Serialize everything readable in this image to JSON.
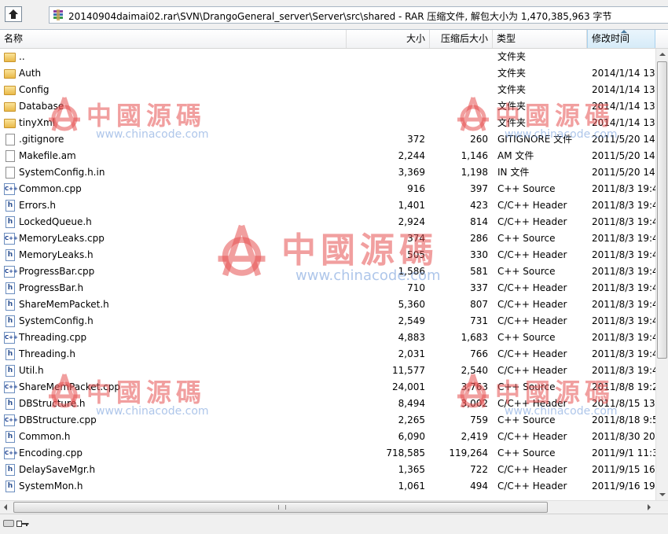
{
  "pathbar": {
    "path": "20140904daimai02.rar\\SVN\\DrangoGeneral_server\\Server\\src\\shared - RAR 压缩文件, 解包大小为 1,470,385,963 字节"
  },
  "columns": {
    "name": "名称",
    "size": "大小",
    "packed": "压缩后大小",
    "type": "类型",
    "modified": "修改时间"
  },
  "files": [
    {
      "icon": "folder-up-icon",
      "name": "..",
      "size": "",
      "packed": "",
      "type": "文件夹",
      "date": ""
    },
    {
      "icon": "folder-icon",
      "name": "Auth",
      "size": "",
      "packed": "",
      "type": "文件夹",
      "date": "2014/1/14 13"
    },
    {
      "icon": "folder-icon",
      "name": "Config",
      "size": "",
      "packed": "",
      "type": "文件夹",
      "date": "2014/1/14 13"
    },
    {
      "icon": "folder-icon",
      "name": "Database",
      "size": "",
      "packed": "",
      "type": "文件夹",
      "date": "2014/1/14 13"
    },
    {
      "icon": "folder-icon",
      "name": "tinyXml",
      "size": "",
      "packed": "",
      "type": "文件夹",
      "date": "2014/1/14 13"
    },
    {
      "icon": "file-icon",
      "name": ".gitignore",
      "size": "372",
      "packed": "260",
      "type": "GITIGNORE 文件",
      "date": "2011/5/20 14"
    },
    {
      "icon": "file-icon",
      "name": "Makefile.am",
      "size": "2,244",
      "packed": "1,146",
      "type": "AM 文件",
      "date": "2011/5/20 14"
    },
    {
      "icon": "file-icon",
      "name": "SystemConfig.h.in",
      "size": "3,369",
      "packed": "1,198",
      "type": "IN 文件",
      "date": "2011/5/20 14"
    },
    {
      "icon": "cpp-file-icon",
      "name": "Common.cpp",
      "size": "916",
      "packed": "397",
      "type": "C++ Source",
      "date": "2011/8/3 19:4"
    },
    {
      "icon": "header-file-icon",
      "name": "Errors.h",
      "size": "1,401",
      "packed": "423",
      "type": "C/C++ Header",
      "date": "2011/8/3 19:4"
    },
    {
      "icon": "header-file-icon",
      "name": "LockedQueue.h",
      "size": "2,924",
      "packed": "814",
      "type": "C/C++ Header",
      "date": "2011/8/3 19:4"
    },
    {
      "icon": "cpp-file-icon",
      "name": "MemoryLeaks.cpp",
      "size": "374",
      "packed": "286",
      "type": "C++ Source",
      "date": "2011/8/3 19:4"
    },
    {
      "icon": "header-file-icon",
      "name": "MemoryLeaks.h",
      "size": "505",
      "packed": "330",
      "type": "C/C++ Header",
      "date": "2011/8/3 19:4"
    },
    {
      "icon": "cpp-file-icon",
      "name": "ProgressBar.cpp",
      "size": "1,586",
      "packed": "581",
      "type": "C++ Source",
      "date": "2011/8/3 19:4"
    },
    {
      "icon": "header-file-icon",
      "name": "ProgressBar.h",
      "size": "710",
      "packed": "337",
      "type": "C/C++ Header",
      "date": "2011/8/3 19:4"
    },
    {
      "icon": "header-file-icon",
      "name": "ShareMemPacket.h",
      "size": "5,360",
      "packed": "807",
      "type": "C/C++ Header",
      "date": "2011/8/3 19:4"
    },
    {
      "icon": "header-file-icon",
      "name": "SystemConfig.h",
      "size": "2,549",
      "packed": "731",
      "type": "C/C++ Header",
      "date": "2011/8/3 19:4"
    },
    {
      "icon": "cpp-file-icon",
      "name": "Threading.cpp",
      "size": "4,883",
      "packed": "1,683",
      "type": "C++ Source",
      "date": "2011/8/3 19:4"
    },
    {
      "icon": "header-file-icon",
      "name": "Threading.h",
      "size": "2,031",
      "packed": "766",
      "type": "C/C++ Header",
      "date": "2011/8/3 19:4"
    },
    {
      "icon": "header-file-icon",
      "name": "Util.h",
      "size": "11,577",
      "packed": "2,540",
      "type": "C/C++ Header",
      "date": "2011/8/3 19:4"
    },
    {
      "icon": "cpp-file-icon",
      "name": "ShareMemPacket.cpp",
      "size": "24,001",
      "packed": "3,763",
      "type": "C++ Source",
      "date": "2011/8/8 19:2"
    },
    {
      "icon": "header-file-icon",
      "name": "DBStructure.h",
      "size": "8,494",
      "packed": "3,002",
      "type": "C/C++ Header",
      "date": "2011/8/15 13"
    },
    {
      "icon": "cpp-file-icon",
      "name": "DBStructure.cpp",
      "size": "2,265",
      "packed": "759",
      "type": "C++ Source",
      "date": "2011/8/18 9:5"
    },
    {
      "icon": "header-file-icon",
      "name": "Common.h",
      "size": "6,090",
      "packed": "2,419",
      "type": "C/C++ Header",
      "date": "2011/8/30 20"
    },
    {
      "icon": "cpp-file-icon",
      "name": "Encoding.cpp",
      "size": "718,585",
      "packed": "119,264",
      "type": "C++ Source",
      "date": "2011/9/1 11:3"
    },
    {
      "icon": "header-file-icon",
      "name": "DelaySaveMgr.h",
      "size": "1,365",
      "packed": "722",
      "type": "C/C++ Header",
      "date": "2011/9/15 16"
    },
    {
      "icon": "header-file-icon",
      "name": "SystemMon.h",
      "size": "1,061",
      "packed": "494",
      "type": "C/C++ Header",
      "date": "2011/9/16 19"
    }
  ],
  "watermark": {
    "cn": "中國源碼",
    "url": "www.chinacode.com"
  },
  "colors": {
    "header_sorted": "#d6ebf8",
    "folder": "#e9b949",
    "watermark_red": "#e65050",
    "watermark_blue": "#78a0dc"
  }
}
